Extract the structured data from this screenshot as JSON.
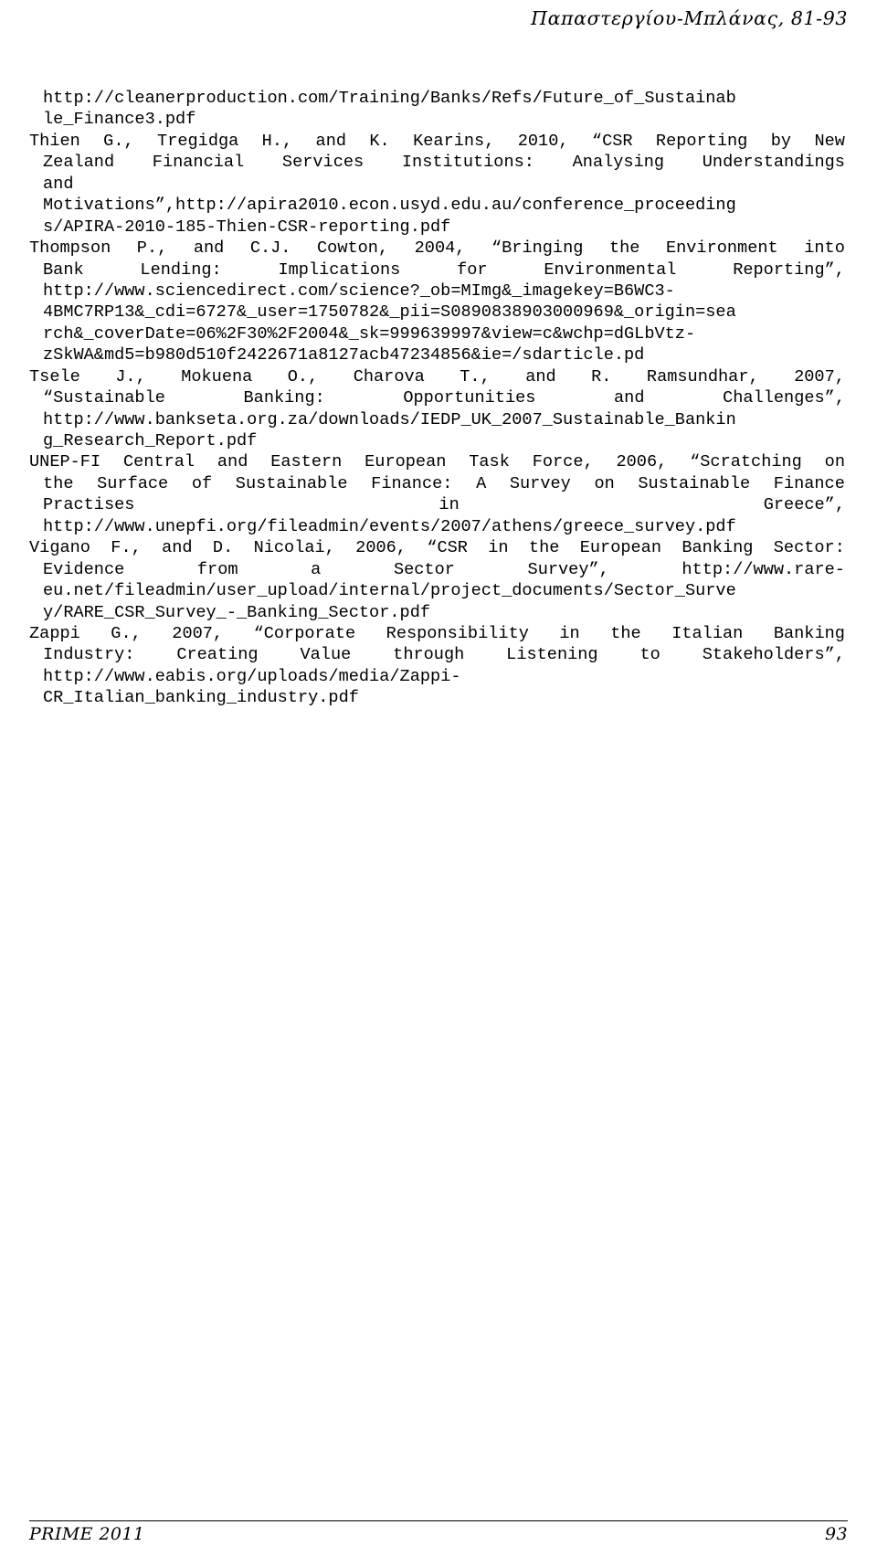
{
  "document": {
    "running_header": "Παπαστεργίου-Μπλάνας, 81-93",
    "footer_left": "PRIME 2011",
    "footer_page_number": "93",
    "text_color": "#000000",
    "background_color": "#ffffff"
  },
  "bibliography": {
    "entries": [
      {
        "id": "ref-thien-continuation",
        "lines": [
          {
            "indent": true,
            "justify": false,
            "words": [
              "http://cleanerproduction.com/Training/Banks/Refs/Future_of_Sustainab"
            ]
          },
          {
            "indent": true,
            "justify": false,
            "words": [
              "le_Finance3.pdf"
            ]
          }
        ]
      },
      {
        "id": "ref-thien-tregidga-kearins",
        "lines": [
          {
            "indent": false,
            "justify": true,
            "words": [
              "Thien",
              "G.,",
              "Tregidga",
              "H.,",
              "and",
              "K.",
              "Kearins,",
              "2010,",
              "“CSR",
              "Reporting",
              "by",
              "New"
            ]
          },
          {
            "indent": true,
            "justify": true,
            "words": [
              "Zealand",
              "Financial",
              "Services",
              "Institutions:",
              "Analysing",
              "Understandings"
            ]
          },
          {
            "indent": true,
            "justify": false,
            "words": [
              "and"
            ]
          },
          {
            "indent": true,
            "justify": false,
            "words": [
              "Motivations”,http://apira2010.econ.usyd.edu.au/conference_proceeding"
            ]
          },
          {
            "indent": true,
            "justify": false,
            "words": [
              "s/APIRA-2010-185-Thien-CSR-reporting.pdf"
            ]
          }
        ]
      },
      {
        "id": "ref-thompson-cowton",
        "lines": [
          {
            "indent": false,
            "justify": true,
            "words": [
              "Thompson",
              "P.,",
              "and",
              "C.J.",
              "Cowton,",
              "2004,",
              "“Bringing",
              "the",
              "Environment",
              "into"
            ]
          },
          {
            "indent": true,
            "justify": true,
            "words": [
              "Bank",
              "Lending:",
              "Implications",
              "for",
              "Environmental",
              "Reporting”,"
            ]
          },
          {
            "indent": true,
            "justify": false,
            "words": [
              "http://www.sciencedirect.com/science?_ob=MImg&_imagekey=B6WC3-"
            ]
          },
          {
            "indent": true,
            "justify": false,
            "words": [
              "4BMC7RP13&_cdi=6727&_user=1750782&_pii=S0890838903000969&_origin=sea"
            ]
          },
          {
            "indent": true,
            "justify": false,
            "words": [
              "rch&_coverDate=06%2F30%2F2004&_sk=999639997&view=c&wchp=dGLbVtz-"
            ]
          },
          {
            "indent": true,
            "justify": false,
            "words": [
              "zSkWA&md5=b980d510f2422671a8127acb47234856&ie=/sdarticle.pd"
            ]
          }
        ]
      },
      {
        "id": "ref-tsele-mokuena-charova-ramsundhar",
        "lines": [
          {
            "indent": false,
            "justify": true,
            "words": [
              "Tsele",
              "J.,",
              "Mokuena",
              "O.,",
              "Charova",
              "T.,",
              "and",
              "R.",
              "Ramsundhar,",
              "2007,"
            ]
          },
          {
            "indent": true,
            "justify": true,
            "words": [
              "“Sustainable",
              "Banking:",
              "Opportunities",
              "and",
              "Challenges”,"
            ]
          },
          {
            "indent": true,
            "justify": false,
            "words": [
              "http://www.bankseta.org.za/downloads/IEDP_UK_2007_Sustainable_Bankin"
            ]
          },
          {
            "indent": true,
            "justify": false,
            "words": [
              "g_Research_Report.pdf"
            ]
          }
        ]
      },
      {
        "id": "ref-unep-fi",
        "lines": [
          {
            "indent": false,
            "justify": true,
            "words": [
              "UNEP-FI",
              "Central",
              "and",
              "Eastern",
              "European",
              "Task",
              "Force,",
              "2006,",
              "“Scratching",
              "on"
            ]
          },
          {
            "indent": true,
            "justify": true,
            "words": [
              "the",
              "Surface",
              "of",
              "Sustainable",
              "Finance:",
              "A",
              "Survey",
              "on",
              "Sustainable",
              "Finance"
            ]
          },
          {
            "indent": true,
            "justify": true,
            "words": [
              "Practises",
              "in",
              "Greece”,"
            ]
          },
          {
            "indent": true,
            "justify": false,
            "words": [
              "http://www.unepfi.org/fileadmin/events/2007/athens/greece_survey.pdf"
            ]
          }
        ]
      },
      {
        "id": "ref-vigano-nicolai",
        "lines": [
          {
            "indent": false,
            "justify": true,
            "words": [
              "Vigano",
              "F.,",
              "and",
              "D.",
              "Nicolai,",
              "2006,",
              "“CSR",
              "in",
              "the",
              "European",
              "Banking",
              "Sector:"
            ]
          },
          {
            "indent": true,
            "justify": true,
            "words": [
              "Evidence",
              "from",
              "a",
              "Sector",
              "Survey”,",
              "http://www.rare-"
            ]
          },
          {
            "indent": true,
            "justify": false,
            "words": [
              "eu.net/fileadmin/user_upload/internal/project_documents/Sector_Surve"
            ]
          },
          {
            "indent": true,
            "justify": false,
            "words": [
              "y/RARE_CSR_Survey_-_Banking_Sector.pdf"
            ]
          }
        ]
      },
      {
        "id": "ref-zappi",
        "lines": [
          {
            "indent": false,
            "justify": true,
            "words": [
              "Zappi",
              "G.,",
              "2007,",
              "“Corporate",
              "Responsibility",
              "in",
              "the",
              "Italian",
              "Banking"
            ]
          },
          {
            "indent": true,
            "justify": true,
            "words": [
              "Industry:",
              "Creating",
              "Value",
              "through",
              "Listening",
              "to",
              "Stakeholders”,"
            ]
          },
          {
            "indent": true,
            "justify": false,
            "words": [
              "http://www.eabis.org/uploads/media/Zappi-"
            ]
          },
          {
            "indent": true,
            "justify": false,
            "words": [
              "CR_Italian_banking_industry.pdf"
            ]
          }
        ]
      }
    ]
  }
}
